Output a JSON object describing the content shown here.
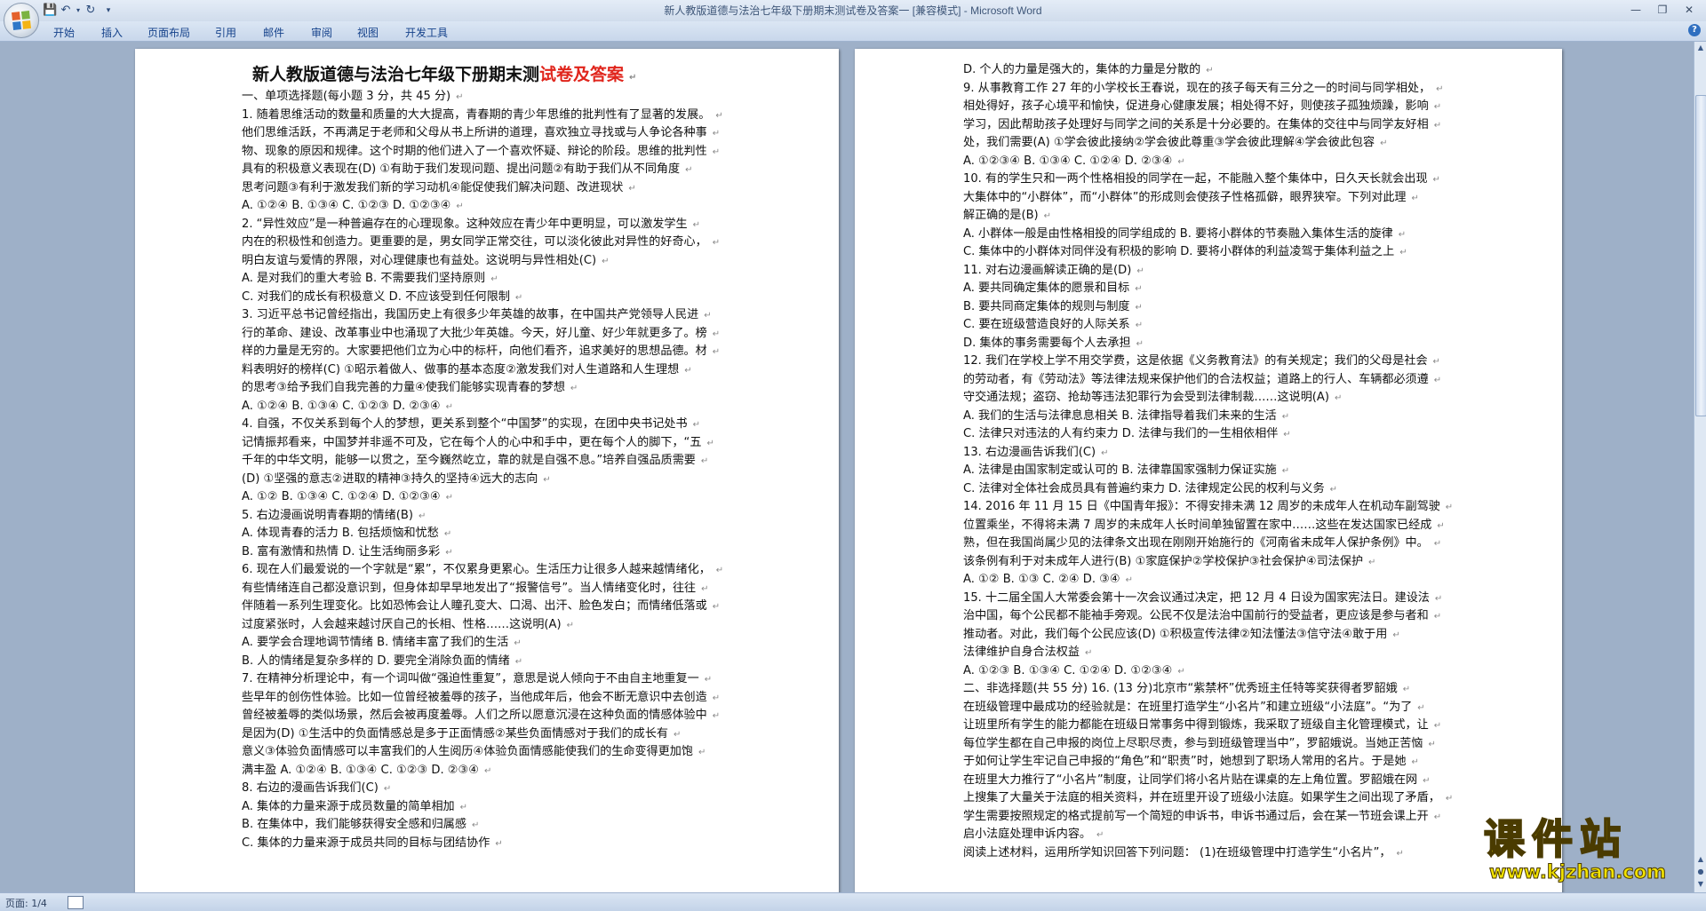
{
  "window": {
    "title": "新人教版道德与法治七年级下册期末测试卷及答案一 [兼容模式]",
    "app_name": " - Microsoft Word"
  },
  "quick_access": {
    "save_icon": "save-icon",
    "undo_icon": "undo-icon",
    "redo_icon": "redo-icon",
    "customize_icon": "chevron-down-icon"
  },
  "ribbon": {
    "tabs": [
      "开始",
      "插入",
      "页面布局",
      "引用",
      "邮件",
      "审阅",
      "视图",
      "开发工具"
    ]
  },
  "document": {
    "title_black": "新人教版道德与法治七年级下册期末测",
    "title_red": "试卷及答案",
    "page1_lines": [
      "一、单项选择题(每小题 3 分，共 45 分)",
      "1. 随着思维活动的数量和质量的大大提高，青春期的青少年思维的批判性有了显著的发展。",
      "他们思维活跃，不再满足于老师和父母从书上所讲的道理，喜欢独立寻找或与人争论各种事",
      "物、现象的原因和规律。这个时期的他们进入了一个喜欢怀疑、辩论的阶段。思维的批判性",
      "具有的积极意义表现在(D)       ①有助于我们发现问题、提出问题②有助于我们从不同角度",
      "思考问题③有利于激发我们新的学习动机④能促使我们解决问题、改进现状",
      "A. ①②④          B. ①③④          C. ①②③          D. ①②③④",
      "2. “异性效应”是一种普遍存在的心理现象。这种效应在青少年中更明显，可以激发学生",
      "内在的积极性和创造力。更重要的是，男女同学正常交往，可以淡化彼此对异性的好奇心，",
      "明白友谊与爱情的界限，对心理健康也有益处。这说明与异性相处(C)",
      "A. 是对我们的重大考验                      B. 不需要我们坚持原则",
      "C. 对我们的成长有积极意义                  D. 不应该受到任何限制",
      "3. 习近平总书记曾经指出，我国历史上有很多少年英雄的故事，在中国共产党领导人民进",
      "行的革命、建设、改革事业中也涌现了大批少年英雄。今天，好儿童、好少年就更多了。榜",
      "样的力量是无穷的。大家要把他们立为心中的标杆，向他们看齐，追求美好的思想品德。材",
      "料表明好的榜样(C)        ①昭示着做人、做事的基本态度②激发我们对人生道路和人生理想",
      "的思考③给予我们自我完善的力量④使我们能够实现青春的梦想",
      "A. ①②④          B. ①③④          C. ①②③          D. ②③④",
      "4. 自强，不仅关系到每个人的梦想，更关系到整个“中国梦”的实现，在团中央书记处书",
      "记情振邦看来，中国梦并非遥不可及，它在每个人的心中和手中，更在每个人的脚下，“五",
      "千年的中华文明，能够一以贯之，至今巍然屹立，靠的就是自强不息。”培养自强品质需要",
      "(D)      ①坚强的意志②进取的精神③持久的坚持④远大的志向",
      "A. ①②          B. ①③④          C. ①②④          D. ①②③④",
      "5. 右边漫画说明青春期的情绪(B)",
      "A. 体现青春的活力                B. 包括烦恼和忧愁",
      "B. 富有激情和热情  D. 让生活绚丽多彩",
      "6. 现在人们最爱说的一个字就是“累”，不仅累身更累心。生活压力让很多人越来越情绪化，",
      "有些情绪连自己都没意识到，但身体却早早地发出了“报警信号”。当人情绪变化时，往往",
      "伴随着一系列生理变化。比如恐怖会让人瞳孔变大、口渴、出汗、脸色发白；而情绪低落或",
      "过度紧张时，人会越来越讨厌自己的长相、性格……这说明(A)",
      "A. 要学会合理地调节情绪                B. 情绪丰富了我们的生活",
      "B. 人的情绪是复杂多样的                D. 要完全消除负面的情绪",
      "7. 在精神分析理论中，有一个词叫做“强迫性重复”，意思是说人倾向于不由自主地重复一",
      "些早年的创伤性体验。比如一位曾经被羞辱的孩子，当他成年后，他会不断无意识中去创造",
      "曾经被羞辱的类似场景，然后会被再度羞辱。人们之所以愿意沉浸在这种负面的情感体验中",
      "是因为(D)       ①生活中的负面情感总是多于正面情感②某些负面情感对于我们的成长有",
      "意义③体验负面情感可以丰富我们的人生阅历④体验负面情感能使我们的生命变得更加饱",
      "满丰盈          A. ①②④          B. ①③④          C. ①②③          D. ②③④",
      "   8.         右边的漫画告诉我们(C)",
      "A. 集体的力量来源于成员数量的简单相加",
      "B. 在集体中，我们能够获得安全感和归属感",
      "C. 集体的力量来源于成员共同的目标与团结协作"
    ],
    "page2_lines": [
      "D. 个人的力量是强大的，集体的力量是分散的",
      "9. 从事教育工作 27 年的小学校长王春说，现在的孩子每天有三分之一的时间与同学相处，",
      "相处得好，孩子心境平和愉快，促进身心健康发展；相处得不好，则使孩子孤独烦躁，影响",
      "学习，因此帮助孩子处理好与同学之间的关系是十分必要的。在集体的交往中与同学友好相",
      "处，我们需要(A)       ①学会彼此接纳②学会彼此尊重③学会彼此理解④学会彼此包容",
      "A. ①②③④          B. ①③④          C. ①②④          D. ②③④",
      "10. 有的学生只和一两个性格相投的同学在一起，不能融入整个集体中，日久天长就会出现",
      "大集体中的“小群体”，而“小群体”的形成则会使孩子性格孤僻，眼界狭窄。下列对此理",
      "解正确的是(B)",
      "A. 小群体一般是由性格相投的同学组成的 B. 要将小群体的节奏融入集体生活的旋律",
      "C. 集体中的小群体对同伴没有积极的影响  D. 要将小群体的利益凌驾于集体利益之上",
      "11.         对右边漫画解读正确的是(D)",
      "A. 要共同确定集体的愿景和目标",
      "B. 要共同商定集体的规则与制度",
      "C. 要在班级营造良好的人际关系",
      "D. 集体的事务需要每个人去承担",
      "12. 我们在学校上学不用交学费，这是依据《义务教育法》的有关规定；我们的父母是社会",
      "的劳动者，有《劳动法》等法律法规来保护他们的合法权益；道路上的行人、车辆都必须遵",
      "守交通法规；盗窃、抢劫等违法犯罪行为会受到法律制裁……这说明(A)",
      "A. 我们的生活与法律息息相关                     B. 法律指导着我们未来的生活",
      "C. 法律只对违法的人有约束力                     D. 法律与我们的一生相依相伴",
      "13. 右边漫画告诉我们(C)",
      "A. 法律是由国家制定或认可的                               B. 法律靠国家强制力保证实施",
      "C. 法律对全体社会成员具有普遍约束力                       D. 法律规定公民的权利与义务",
      "14. 2016 年 11 月 15 日《中国青年报》：不得安排未满 12 周岁的未成年人在机动车副驾驶",
      "位置乘坐，不得将未满 7 周岁的未成年人长时间单独留置在家中……这些在发达国家已经成",
      "熟，但在我国尚属少见的法律条文出现在刚刚开始施行的《河南省未成年人保护条例》中。",
      "该条例有利于对未成年人进行(B)        ①家庭保护②学校保护③社会保护④司法保护",
      "A. ①②          B. ①③          C. ②④          D. ③④",
      "15. 十二届全国人大常委会第十一次会议通过决定，把 12 月 4 日设为国家宪法日。建设法",
      "治中国，每个公民都不能袖手旁观。公民不仅是法治中国前行的受益者，更应该是参与者和",
      "推动者。对此，我们每个公民应该(D)       ①积极宣传法律②知法懂法③信守法④敢于用",
      "法律维护自身合法权益",
      "A. ①②③          B. ①③④          C. ①②④          D. ①②③④",
      "二、非选择题(共 55 分)          16. (13 分)北京市“紫禁杯”优秀班主任特等奖获得者罗韶娥",
      "在班级管理中最成功的经验就是：在班里打造学生“小名片”和建立班级“小法庭”。“为了",
      "让班里所有学生的能力都能在班级日常事务中得到锻炼，我采取了班级自主化管理模式，让",
      "每位学生都在自己申报的岗位上尽职尽责，参与到班级管理当中”，罗韶娥说。当她正苦恼",
      "于如何让学生牢记自己申报的“角色”和“职责”时，她想到了职场人常用的名片。于是她",
      "在班里大力推行了“小名片”制度，让同学们将小名片贴在课桌的左上角位置。罗韶娥在网",
      "上搜集了大量关于法庭的相关资料，并在班里开设了班级小法庭。如果学生之间出现了矛盾，",
      "学生需要按照规定的格式提前写一个简短的申诉书，申诉书通过后，会在某一节班会课上开",
      "启小法庭处理申诉内容。",
      "阅读上述材料，运用所学知识回答下列问题：        (1)在班级管理中打造学生“小名片”，"
    ]
  },
  "status": {
    "page": "页面: 1/4"
  },
  "watermark": {
    "logo": "课件站",
    "url": "www.kjzhan.com"
  }
}
